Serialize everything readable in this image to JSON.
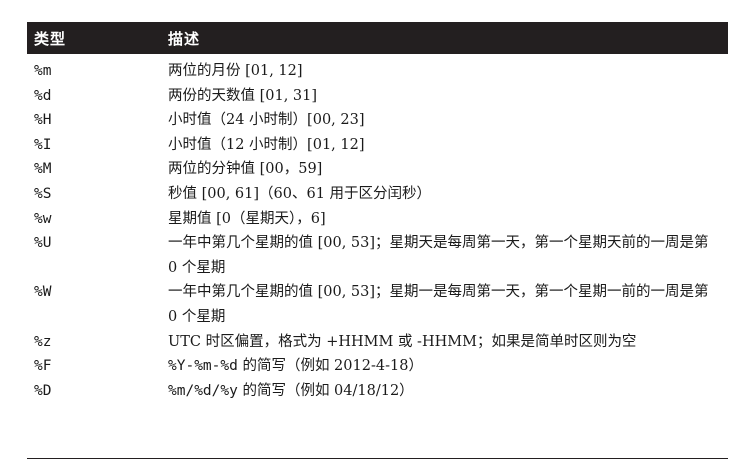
{
  "table": {
    "headers": [
      "类型",
      "描述"
    ],
    "rows": [
      {
        "code": "%m",
        "desc": "两位的月份 [01, 12]"
      },
      {
        "code": "%d",
        "desc": "两份的天数值 [01, 31]"
      },
      {
        "code": "%H",
        "desc": "小时值（24 小时制）[00, 23]"
      },
      {
        "code": "%I",
        "desc": "小时值（12 小时制）[01, 12]"
      },
      {
        "code": "%M",
        "desc": "两位的分钟值 [00，59]"
      },
      {
        "code": "%S",
        "desc": "秒值 [00, 61]（60、61 用于区分闰秒）"
      },
      {
        "code": "%w",
        "desc": "星期值 [0（星期天），6]"
      },
      {
        "code": "%U",
        "desc": "一年中第几个星期的值 [00, 53]；星期天是每周第一天，第一个星期天前的一周是第 0 个星期"
      },
      {
        "code": "%W",
        "desc": "一年中第几个星期的值 [00, 53]；星期一是每周第一天，第一个星期一前的一周是第 0 个星期"
      },
      {
        "code": "%z",
        "desc": "UTC 时区偏置，格式为 +HHMM 或 -HHMM；如果是简单时区则为空"
      },
      {
        "code": "%F",
        "desc_mono": "%Y-%m-%d",
        "desc": " 的简写（例如 2012-4-18）"
      },
      {
        "code": "%D",
        "desc_mono": "%m/%d/%y",
        "desc": " 的简写（例如 04/18/12）"
      }
    ]
  }
}
